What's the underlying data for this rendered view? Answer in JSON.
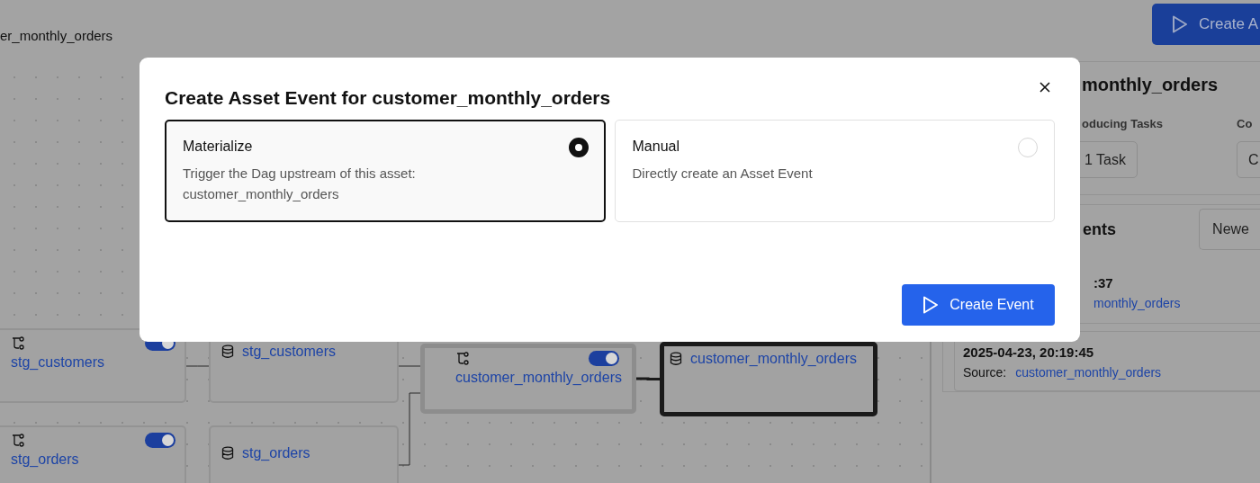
{
  "header": {
    "breadcrumb": "er_monthly_orders",
    "action_button": "Create A"
  },
  "graph": {
    "nodes": [
      {
        "kind": "task",
        "label": "stg_customers",
        "enabled": true,
        "highlighted": false,
        "selected": false
      },
      {
        "kind": "asset",
        "label": "stg_customers",
        "highlighted": false,
        "selected": false
      },
      {
        "kind": "task",
        "label": "customer_monthly_orders",
        "enabled": true,
        "highlighted": true,
        "selected": false
      },
      {
        "kind": "asset",
        "label": "customer_monthly_orders",
        "highlighted": false,
        "selected": true
      },
      {
        "kind": "task",
        "label": "stg_orders",
        "enabled": true,
        "highlighted": false,
        "selected": false
      },
      {
        "kind": "asset",
        "label": "stg_orders",
        "highlighted": false,
        "selected": false
      }
    ]
  },
  "details": {
    "title": "monthly_orders",
    "columns": [
      {
        "label": "oducing Tasks",
        "button": "1 Task"
      },
      {
        "label": "Co",
        "button": "C"
      }
    ],
    "events": {
      "title": "ents",
      "sort_button": "Newe",
      "items": [
        {
          "timestamp": ":37",
          "source": "monthly_orders"
        },
        {
          "timestamp": "2025-04-23, 20:19:45",
          "source_label": "Source:",
          "source": "customer_monthly_orders"
        }
      ]
    }
  },
  "modal": {
    "title": "Create Asset Event for customer_monthly_orders",
    "options": [
      {
        "title": "Materialize",
        "description": "Trigger the Dag upstream of this asset: customer_monthly_orders",
        "selected": true
      },
      {
        "title": "Manual",
        "description": "Directly create an Asset Event",
        "selected": false
      }
    ],
    "submit_button": "Create Event"
  }
}
